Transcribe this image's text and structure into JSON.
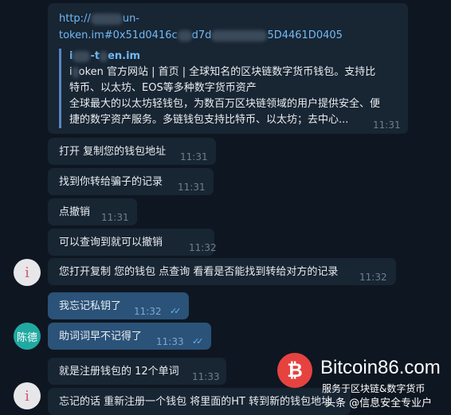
{
  "colors": {
    "background": "#0e1621",
    "incoming_bubble": "#182533",
    "outgoing_bubble": "#2b5278",
    "link": "#71baf5",
    "accent_bar": "#5288c1",
    "read_ticks": "#64b5ef"
  },
  "link_message": {
    "url_part1": "http://",
    "url_part2": "un-",
    "url_part3": "token.im#0x51d0416c",
    "url_part4": "d7d",
    "url_part5": "5D4461D0405",
    "preview_site_a": "i",
    "preview_site_b": "-t",
    "preview_site_c": "en.im",
    "preview_title_a": "i",
    "preview_title_b": "oken 官方网站 | 首页 | 全球知名的区块链数字货币钱包。支持比",
    "preview_title_line2": "特币、以太坊、EOS等多种数字货币资产",
    "preview_desc_line1": "全球最大的以太坊轻钱包，为数百万区块链领域的用户提供安全、便",
    "preview_desc_line2": "捷的数字资产服务。多链钱包支持比特币、以太坊；去中心...",
    "time": "11:31"
  },
  "messages": [
    {
      "text": "打开 复制您的钱包地址",
      "time": "11:31"
    },
    {
      "text": "找到你转给骗子的记录",
      "time": "11:31"
    },
    {
      "text": "点撤销",
      "time": "11:31"
    },
    {
      "text": "可以查询到就可以撤销",
      "time": "11:32"
    },
    {
      "text": "您打开复制 您的钱包 点查询 看看是否能找到转给对方的记录",
      "time": "11:32"
    },
    {
      "text": "我忘记私钥了",
      "time": "11:32",
      "ticks": "✓✓"
    },
    {
      "text": "助词词早不记得了",
      "time": "11:33",
      "ticks": "✓✓"
    },
    {
      "text": "就是注册钱包的 12个单词",
      "time": "11:33"
    },
    {
      "text": "忘记的话 重新注册一个钱包 将里面的HT 转到新的钱包地址",
      "time": ""
    }
  ],
  "avatars": {
    "other_initial": "i",
    "user_name": "陈德"
  },
  "watermark": {
    "logo_symbol": "₿",
    "title": "Bitcoin86.com",
    "subtitle": "服务于区块链&数字货币",
    "author": "头条 @信息安全专业户"
  }
}
